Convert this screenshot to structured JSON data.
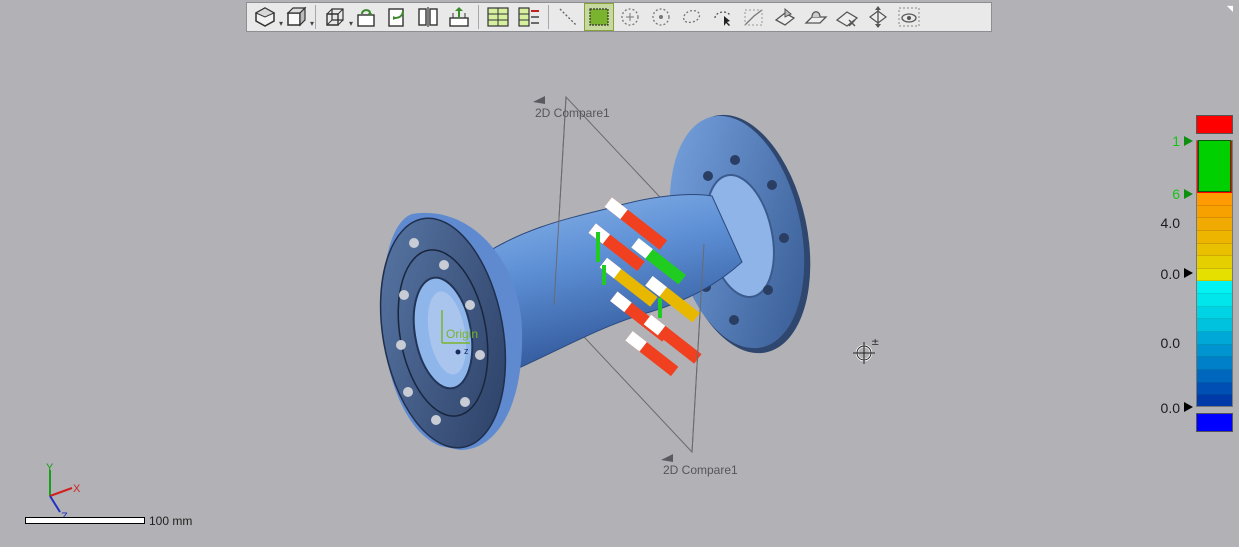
{
  "toolbar": {
    "buttons": [
      {
        "icon": "shaded-solid-icon",
        "dropdown": true
      },
      {
        "icon": "box-view-icon",
        "dropdown": true
      },
      {
        "icon": "wireframe-box-icon",
        "dropdown": true
      },
      {
        "icon": "view-front-rotate-icon"
      },
      {
        "icon": "view-side-rotate-icon"
      },
      {
        "icon": "split-view-icon"
      },
      {
        "icon": "align-plane-icon"
      },
      {
        "icon": "report-grid-icon"
      },
      {
        "icon": "report-list-icon"
      },
      {
        "icon": "line-select-icon"
      },
      {
        "icon": "rectangle-select-icon",
        "active": true
      },
      {
        "icon": "circle-select-icon"
      },
      {
        "icon": "circle-center-select-icon"
      },
      {
        "icon": "lasso-select-icon"
      },
      {
        "icon": "brush-select-icon"
      },
      {
        "icon": "polyline-select-icon"
      },
      {
        "icon": "surface-select-icon"
      },
      {
        "icon": "plane-select-icon"
      },
      {
        "icon": "feature-select-icon"
      },
      {
        "icon": "normal-flip-icon"
      },
      {
        "icon": "visible-only-icon"
      }
    ]
  },
  "scene": {
    "plane_labels": [
      "2D Compare1",
      "2D Compare1"
    ],
    "origin_label": "Origin",
    "origin_axis": "z"
  },
  "color_scale": {
    "labels": [
      "1",
      "6",
      "4.0",
      "0.0",
      "0.0",
      "0.0"
    ],
    "top_color": "#ff0000",
    "bottom_color": "#0000ff",
    "in_tolerance_color": "#00cc00",
    "segments": [
      "#ff9a00",
      "#f7a100",
      "#f1ab00",
      "#edb400",
      "#e9c000",
      "#e6cf00",
      "#e5e000",
      "#00f2f2",
      "#00e6ea",
      "#00d4e4",
      "#00c2de",
      "#00a8d8",
      "#0094d0",
      "#0080c8",
      "#0067be",
      "#004fb4",
      "#003aa8"
    ]
  },
  "triad": {
    "y": "Y",
    "x": "X",
    "z": "Z"
  },
  "scale_bar": {
    "label": "100 mm"
  },
  "colors": {
    "background": "#b2b2b6",
    "part": "#5a8fd6"
  }
}
